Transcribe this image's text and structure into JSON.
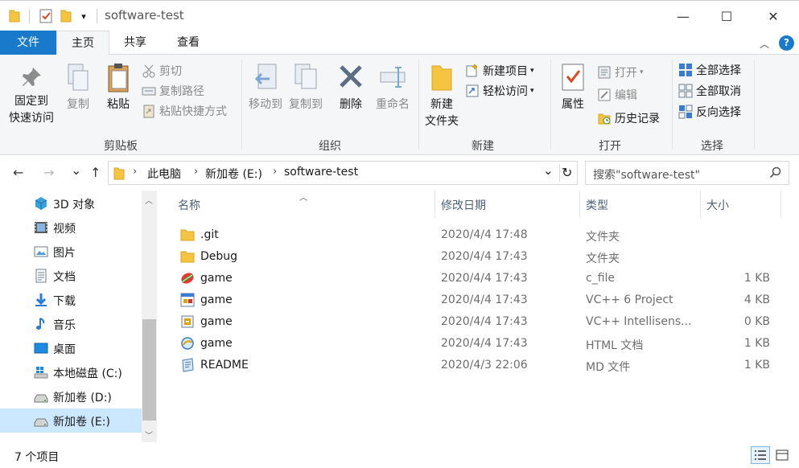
{
  "window": {
    "title": "software-test",
    "controls": {
      "minimize": "—",
      "maximize": "☐",
      "close": "✕"
    }
  },
  "quick_access": {
    "dropdown": "▾"
  },
  "ribbon": {
    "tabs": [
      {
        "label": "文件",
        "active": false
      },
      {
        "label": "主页",
        "active": true
      },
      {
        "label": "共享",
        "active": false
      },
      {
        "label": "查看",
        "active": false
      }
    ],
    "collapse": "︿",
    "help": "?",
    "groups": {
      "clipboard": {
        "label": "剪贴板",
        "pin_line1": "固定到",
        "pin_line2": "快速访问",
        "copy": "复制",
        "paste": "粘贴",
        "cut": "剪切",
        "copy_path": "复制路径",
        "paste_shortcut": "粘贴快捷方式"
      },
      "organize": {
        "label": "组织",
        "move_to": "移动到",
        "copy_to": "复制到",
        "delete": "删除",
        "rename": "重命名"
      },
      "new": {
        "label": "新建",
        "new_folder_line1": "新建",
        "new_folder_line2": "文件夹",
        "new_item": "新建项目",
        "easy_access": "轻松访问"
      },
      "open": {
        "label": "打开",
        "properties": "属性",
        "open": "打开",
        "edit": "编辑",
        "history": "历史记录"
      },
      "select": {
        "label": "选择",
        "select_all": "全部选择",
        "select_none": "全部取消",
        "invert": "反向选择"
      }
    }
  },
  "address": {
    "back": "←",
    "forward": "→",
    "recent": "⌄",
    "up": "↑",
    "crumbs": [
      "此电脑",
      "新加卷 (E:)",
      "software-test"
    ],
    "crumb_sep": "›",
    "refresh": "↻",
    "dropdown": "⌄"
  },
  "search": {
    "placeholder": "搜索\"software-test\""
  },
  "nav_pane": {
    "items": [
      {
        "label": "3D 对象",
        "icon": "3d-objects-icon",
        "selected": false
      },
      {
        "label": "视频",
        "icon": "video-icon",
        "selected": false
      },
      {
        "label": "图片",
        "icon": "pictures-icon",
        "selected": false
      },
      {
        "label": "文档",
        "icon": "documents-icon",
        "selected": false
      },
      {
        "label": "下载",
        "icon": "downloads-icon",
        "selected": false
      },
      {
        "label": "音乐",
        "icon": "music-icon",
        "selected": false
      },
      {
        "label": "桌面",
        "icon": "desktop-icon",
        "selected": false
      },
      {
        "label": "本地磁盘 (C:)",
        "icon": "windows-drive-icon",
        "selected": false
      },
      {
        "label": "新加卷 (D:)",
        "icon": "drive-icon",
        "selected": false
      },
      {
        "label": "新加卷 (E:)",
        "icon": "drive-icon",
        "selected": true
      }
    ]
  },
  "file_list": {
    "columns": {
      "name": "名称",
      "date": "修改日期",
      "type": "类型",
      "size": "大小"
    },
    "sort_indicator": "︿",
    "rows": [
      {
        "name": ".git",
        "date": "2020/4/4 17:48",
        "type": "文件夹",
        "size": "",
        "icon": "folder-icon"
      },
      {
        "name": "Debug",
        "date": "2020/4/4 17:43",
        "type": "文件夹",
        "size": "",
        "icon": "folder-icon"
      },
      {
        "name": "game",
        "date": "2020/4/4 17:43",
        "type": "c_file",
        "size": "1 KB",
        "icon": "c-file-icon"
      },
      {
        "name": "game",
        "date": "2020/4/4 17:43",
        "type": "VC++ 6 Project",
        "size": "4 KB",
        "icon": "vc-project-icon"
      },
      {
        "name": "game",
        "date": "2020/4/4 17:43",
        "type": "VC++ Intellisens...",
        "size": "0 KB",
        "icon": "intellisense-icon"
      },
      {
        "name": "game",
        "date": "2020/4/4 17:43",
        "type": "HTML 文档",
        "size": "1 KB",
        "icon": "html-icon"
      },
      {
        "name": "README",
        "date": "2020/4/3 22:06",
        "type": "MD 文件",
        "size": "1 KB",
        "icon": "markdown-icon"
      }
    ]
  },
  "status": {
    "item_count": "7 个项目"
  },
  "colors": {
    "accent": "#1979ca",
    "selected_bg": "#cce8ff",
    "folder": "#f5c542"
  }
}
